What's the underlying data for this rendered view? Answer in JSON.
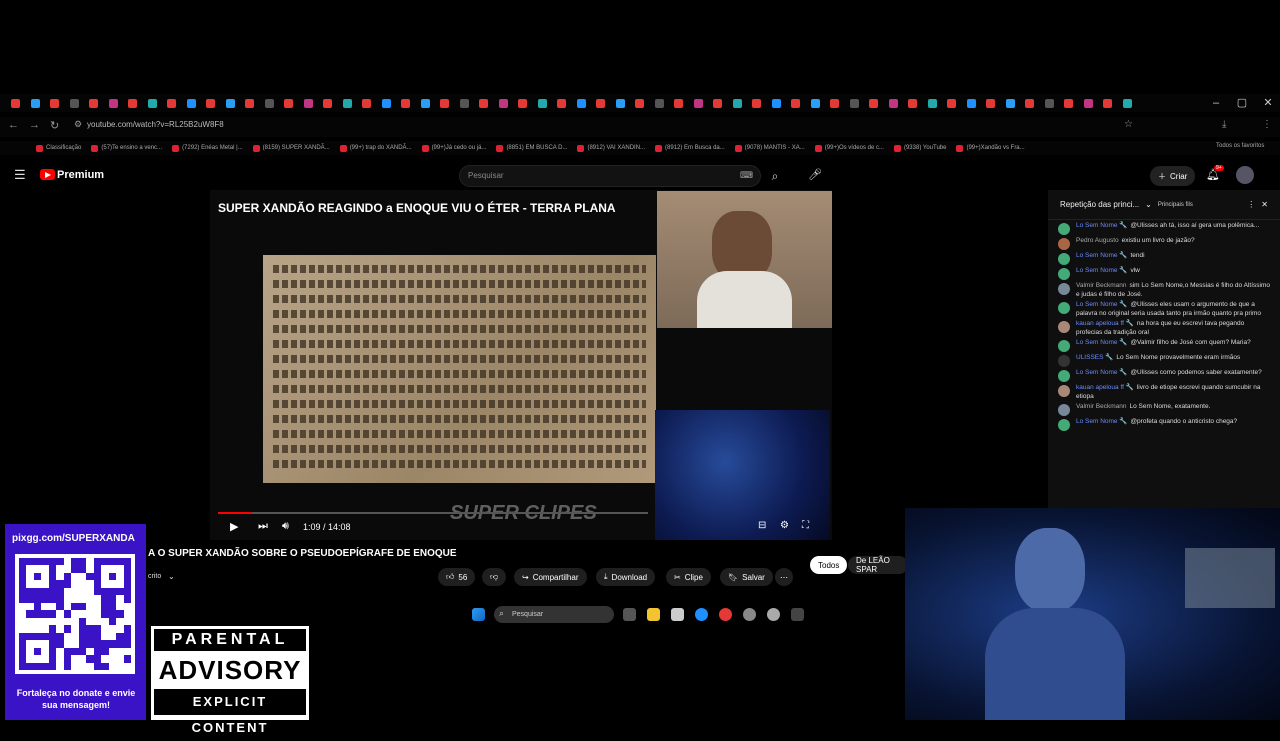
{
  "browser": {
    "url": "youtube.com/watch?v=RL25B2uW8F8",
    "bookmarks": [
      "Classificação",
      "(57)Te ensino a venc...",
      "(7292) Enéas Metal |...",
      "(8159) SUPER XANDÃ...",
      "(99+) trap do XANDÃ...",
      "(99+)Já cedo ou já...",
      "(8851) EM BUSCA D...",
      "(8912) VAI XANDIN...",
      "(8912) Em Busca da...",
      "(9078) MANTIS - XA...",
      "(99+)Os vídeos de c...",
      "(9338) YouTube",
      "(99+)Xandão vs Fra..."
    ],
    "all_bookmarks": "Todos os favoritos"
  },
  "youtube": {
    "premium_label": "Premium",
    "search_placeholder": "Pesquisar",
    "create_label": "Criar",
    "notif_count": "9+"
  },
  "video": {
    "overlay_title": "SUPER XANDÃO REAGINDO a ENOQUE VIU O ÉTER - TERRA PLANA",
    "watermark": "SUPER CLIPES",
    "time": "1:09 / 14:08",
    "progress_fraction": 0.08
  },
  "below_video": {
    "title": "A O SUPER XANDÃO SOBRE O PSEUDOEPÍGRAFE DE ENOQUE",
    "subscribe": "crito",
    "likes": "56",
    "share": "Compartilhar",
    "download": "Download",
    "clip": "Clipe",
    "save": "Salvar",
    "chip_all": "Todos",
    "chip_other": "De LEÃO SPAR"
  },
  "chat": {
    "header": "Repetição das princi...",
    "filter": "Principais fils",
    "messages": [
      {
        "author": "Lo Sem Nome 🔧",
        "text": "@Ulisses ah tá, isso aí gera uma polêmica...",
        "highlight": true
      },
      {
        "author": "Pedro Augusto",
        "text": "existiu um livro de jazão?",
        "highlight": false
      },
      {
        "author": "Lo Sem Nome 🔧",
        "text": "tendi",
        "highlight": true
      },
      {
        "author": "Lo Sem Nome 🔧",
        "text": "vlw",
        "highlight": true
      },
      {
        "author": "Valmir Beckmann",
        "text": "sim Lo Sem Nome,o Messias é filho do Altíssimo e judas é filho de José.",
        "highlight": false
      },
      {
        "author": "Lo Sem Nome 🔧",
        "text": "@Ulisses eles usam o argumento de que a palavra no original seria usada tanto pra irmão quanto pra primo",
        "highlight": true
      },
      {
        "author": "kauan apeloua ff 🔧",
        "text": "na hora que eu escrevi tava pegando profecias da tradição oral",
        "highlight": true
      },
      {
        "author": "Lo Sem Nome 🔧",
        "text": "@Valmir filho de José com quem? Maria?",
        "highlight": true
      },
      {
        "author": "ULISSES 🔧",
        "text": "Lo Sem Nome provavelmente eram irmãos",
        "highlight": true
      },
      {
        "author": "Lo Sem Nome 🔧",
        "text": "@Ulisses como podemos saber exatamente?",
        "highlight": true
      },
      {
        "author": "kauan apeloua ff 🔧",
        "text": "livro de etiope escrevi quando sumcubir na etiopa",
        "highlight": true
      },
      {
        "author": "Valmir Beckmann",
        "text": "Lo Sem Nome, exatamente.",
        "highlight": false
      },
      {
        "author": "Lo Sem Nome 🔧",
        "text": "@profeta quando o anticristo chega?",
        "highlight": true
      }
    ]
  },
  "taskbar": {
    "search": "Pesquisar"
  },
  "qr_panel": {
    "url": "pixgg.com/SUPERXANDA",
    "message": "Fortaleça no donate e envie sua mensagem!"
  },
  "advisory": {
    "line1": "PARENTAL",
    "line2": "ADVISORY",
    "line3": "EXPLICIT CONTENT"
  },
  "colors": {
    "youtube_red": "#ff0000",
    "qr_purple": "#3a13c6",
    "chat_name": "#6b8cff"
  }
}
